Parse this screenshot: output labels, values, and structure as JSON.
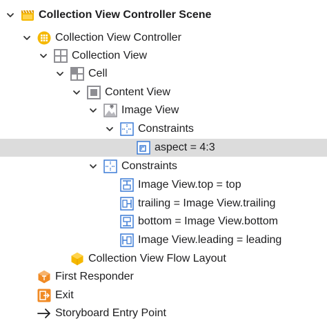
{
  "tree": {
    "scene": "Collection View Controller Scene",
    "controller": "Collection View Controller",
    "collection_view": "Collection View",
    "cell": "Cell",
    "content_view": "Content View",
    "image_view": "Image View",
    "image_view_constraints": "Constraints",
    "aspect_constraint": "aspect = 4:3",
    "content_constraints": "Constraints",
    "constraint_top": "Image View.top = top",
    "constraint_trailing": "trailing = Image View.trailing",
    "constraint_bottom": "bottom = Image View.bottom",
    "constraint_leading": "Image View.leading = leading",
    "flow_layout": "Collection View Flow Layout",
    "first_responder": "First Responder",
    "exit": "Exit",
    "entry_point": "Storyboard Entry Point"
  },
  "colors": {
    "selection": "#dcdcdc",
    "constraint_blue": "#3b7bd6",
    "controller_yellow": "#f5b800",
    "responder_orange": "#f08a24",
    "view_gray": "#8e8e93"
  },
  "selected_item": "aspect = 4:3"
}
